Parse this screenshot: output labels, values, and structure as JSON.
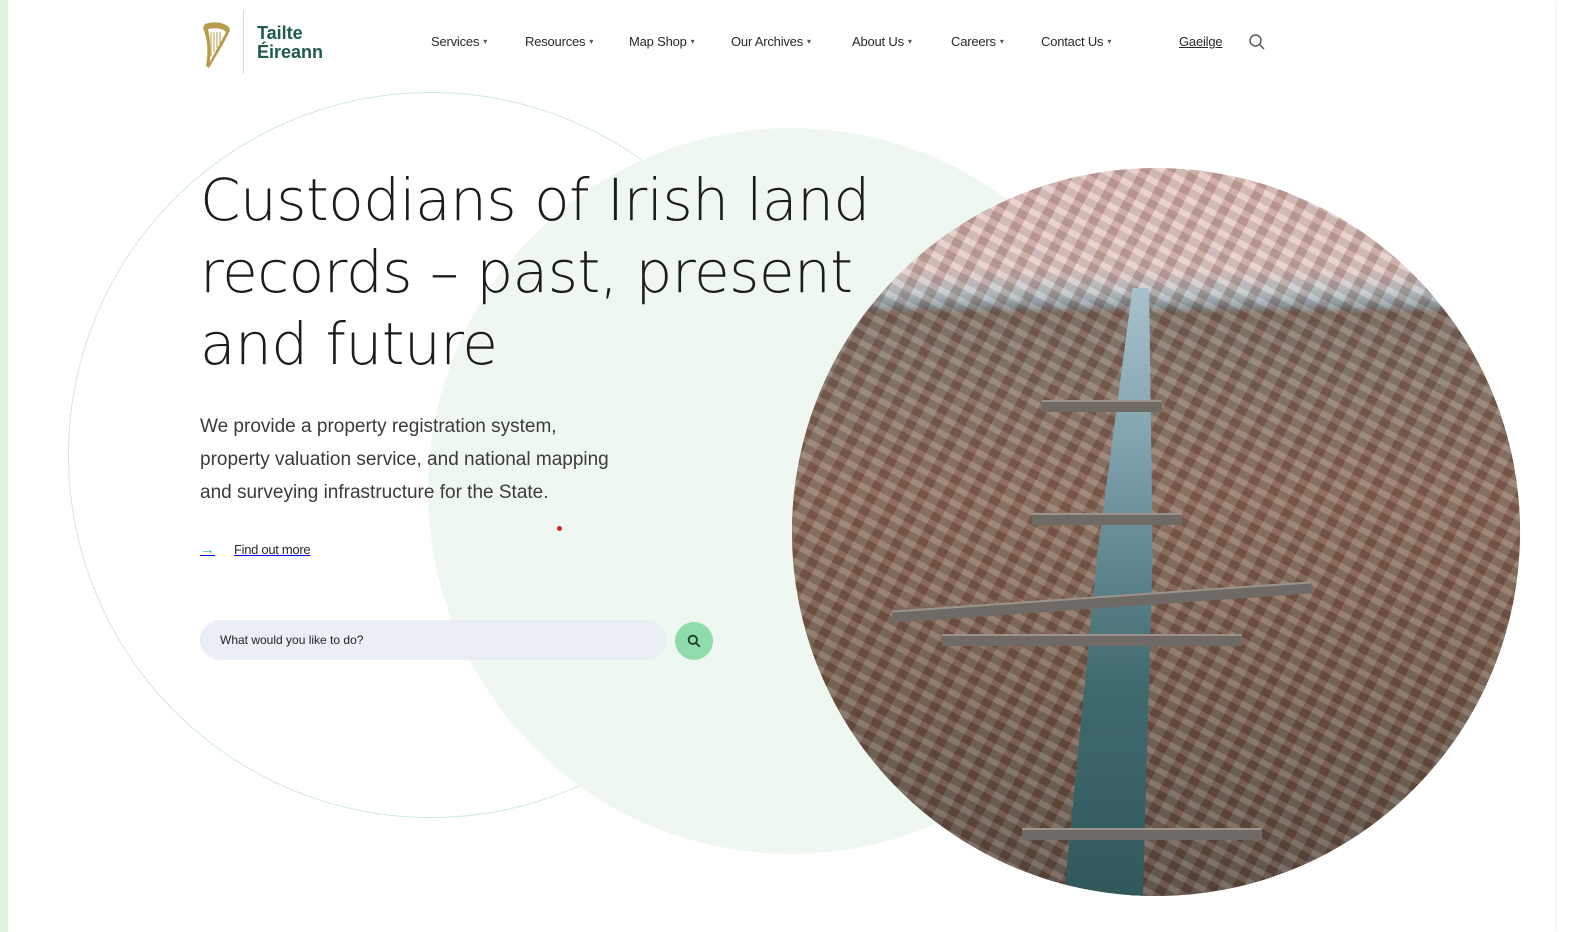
{
  "brand": {
    "name_line1": "Tailte",
    "name_line2": "Éireann",
    "logo_icon": "harp-icon",
    "brand_color": "#1d5b4c"
  },
  "nav": {
    "items": [
      {
        "label": "Services"
      },
      {
        "label": "Resources"
      },
      {
        "label": "Map Shop"
      },
      {
        "label": "Our Archives"
      },
      {
        "label": "About Us"
      },
      {
        "label": "Careers"
      },
      {
        "label": "Contact Us"
      }
    ],
    "caret": "▾",
    "language_link": "Gaeilge",
    "search_icon": "search-icon"
  },
  "hero": {
    "title_lines": [
      "Custodians of Irish land",
      "records – past, present",
      "and future"
    ],
    "description_lines": [
      "We provide a property registration system,",
      "property valuation service, and national mapping",
      "and surveying infrastructure for the State."
    ],
    "cta_arrow": "→",
    "cta_label": "Find out more",
    "image_alt": "Aerial view of Dublin city and the River Liffey"
  },
  "search": {
    "placeholder": "What would you like to do?",
    "button_icon": "search-icon"
  },
  "colors": {
    "accent_green": "#4fc17a",
    "search_button_bg": "#8fdcaa",
    "circle_fill": "#eef8f1",
    "search_field_bg": "#eaeef6"
  }
}
